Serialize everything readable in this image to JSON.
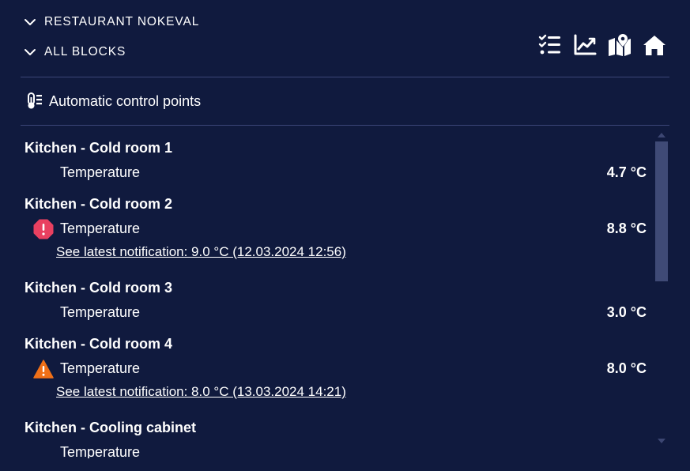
{
  "header": {
    "breadcrumbs": [
      {
        "label": "RESTAURANT NOKEVAL",
        "icon": "chevron-down-icon"
      },
      {
        "label": "ALL BLOCKS",
        "icon": "chevron-down-icon"
      }
    ],
    "toolbar": [
      "checklist-icon",
      "chart-line-icon",
      "map-icon",
      "home-icon"
    ]
  },
  "section": {
    "title": "Automatic control points",
    "icon": "thermometer-list-icon"
  },
  "groups": [
    {
      "title": "Kitchen - Cold room 1",
      "reading_label": "Temperature",
      "value": "4.7 °C",
      "status": "ok",
      "notification": ""
    },
    {
      "title": "Kitchen - Cold room 2",
      "reading_label": "Temperature",
      "value": "8.8 °C",
      "status": "alarm",
      "notification": "See latest notification: 9.0 °C (12.03.2024 12:56)"
    },
    {
      "title": "Kitchen - Cold room 3",
      "reading_label": "Temperature",
      "value": "3.0 °C",
      "status": "ok",
      "notification": ""
    },
    {
      "title": "Kitchen - Cold room 4",
      "reading_label": "Temperature",
      "value": "8.0 °C",
      "status": "warning",
      "notification": "See latest notification: 8.0 °C (13.03.2024 14:21)"
    },
    {
      "title": "Kitchen - Cooling cabinet",
      "reading_label": "Temperature",
      "value": "",
      "status": "ok",
      "notification": ""
    }
  ],
  "colors": {
    "background": "#101a3e",
    "divider": "#3b4577",
    "alarm": "#e94060",
    "warning": "#f07018",
    "scrollbar": "#3f4a76"
  }
}
